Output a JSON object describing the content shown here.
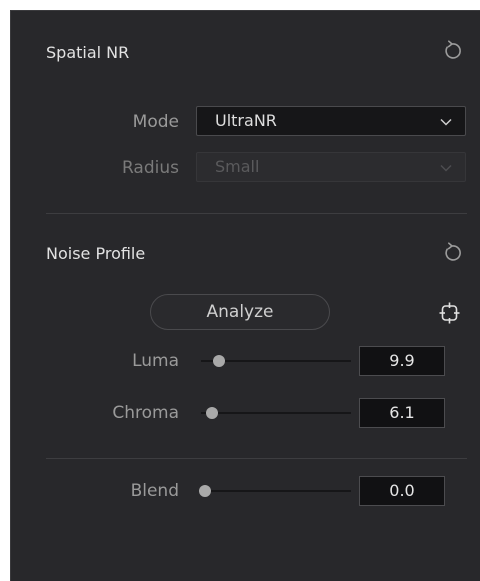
{
  "spatial_nr": {
    "title": "Spatial NR",
    "mode": {
      "label": "Mode",
      "value": "UltraNR"
    },
    "radius": {
      "label": "Radius",
      "value": "Small"
    }
  },
  "noise_profile": {
    "title": "Noise Profile",
    "analyze_label": "Analyze",
    "luma": {
      "label": "Luma",
      "value": "9.9"
    },
    "chroma": {
      "label": "Chroma",
      "value": "6.1"
    }
  },
  "blend": {
    "label": "Blend",
    "value": "0.0"
  },
  "icons": {
    "reset": "reset-icon",
    "dropdown": "chevron-down-icon",
    "picker": "picker-target-icon"
  },
  "colors": {
    "panel": "#28282b",
    "field": "#161618",
    "thumb": "#a9a9a9",
    "text": "#e2e2e2"
  }
}
